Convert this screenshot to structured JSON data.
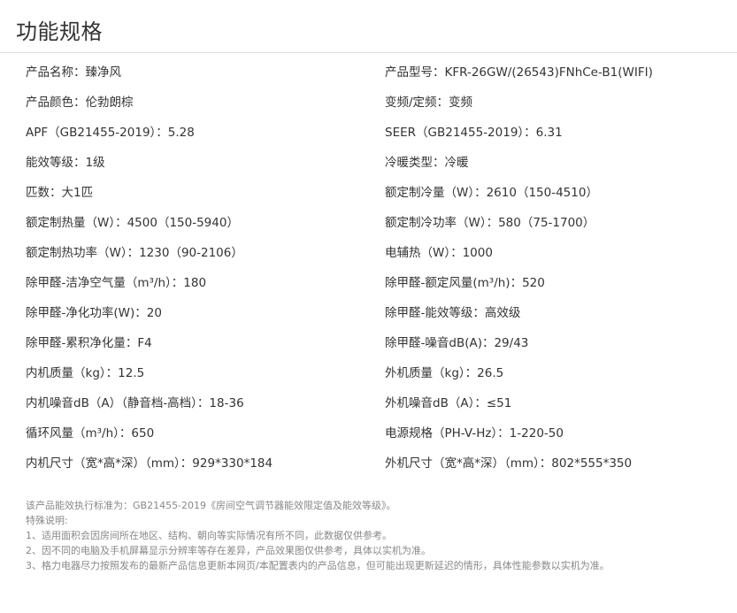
{
  "header": {
    "title": "功能规格"
  },
  "specs": [
    {
      "left": "产品名称：臻净风",
      "right": "产品型号：KFR-26GW/(26543)FNhCe-B1(WIFI)"
    },
    {
      "left": "产品颜色：伦勃朗棕",
      "right": "变频/定频：变频"
    },
    {
      "left": "APF（GB21455-2019）：5.28",
      "right": "SEER（GB21455-2019）：6.31"
    },
    {
      "left": "能效等级：1级",
      "right": "冷暖类型：冷暖"
    },
    {
      "left": "匹数：大1匹",
      "right": "额定制冷量（W）：2610（150-4510）"
    },
    {
      "left": "额定制热量（W）：4500（150-5940）",
      "right": "额定制冷功率（W）：580（75-1700）"
    },
    {
      "left": "额定制热功率（W）：1230（90-2106）",
      "right": "电辅热（W）：1000"
    },
    {
      "left": "除甲醛-洁净空气量（m³/h）：180",
      "right": "除甲醛-额定风量(m³/h)：520"
    },
    {
      "left": "除甲醛-净化功率(W)：20",
      "right": "除甲醛-能效等级：高效级"
    },
    {
      "left": "除甲醛-累积净化量：F4",
      "right": "除甲醛-噪音dB(A)：29/43"
    },
    {
      "left": "内机质量（kg）：12.5",
      "right": "外机质量（kg）：26.5"
    },
    {
      "left": "内机噪音dB（A）（静音档-高档）：18-36",
      "right": "外机噪音dB（A）：≤51"
    },
    {
      "left": "循环风量（m³/h）：650",
      "right": "电源规格（PH-V-Hz）：1-220-50"
    },
    {
      "left": "内机尺寸（宽*高*深）（mm）：929*330*184",
      "right": "外机尺寸（宽*高*深）（mm）：802*555*350"
    }
  ],
  "notes": [
    "该产品能效执行标准为：GB21455-2019《房间空气调节器能效限定值及能效等级》。",
    "特殊说明:",
    "1、适用面积会因房间所在地区、结构、朝向等实际情况有所不同，此数据仅供参考。",
    "2、因不同的电脑及手机屏幕显示分辨率等存在差异，产品效果图仅供参考，具体以实机为准。",
    "3、格力电器尽力按照发布的最新产品信息更新本网页/本配置表内的产品信息，但可能出现更新延迟的情形，具体性能参数以实机为准。"
  ]
}
